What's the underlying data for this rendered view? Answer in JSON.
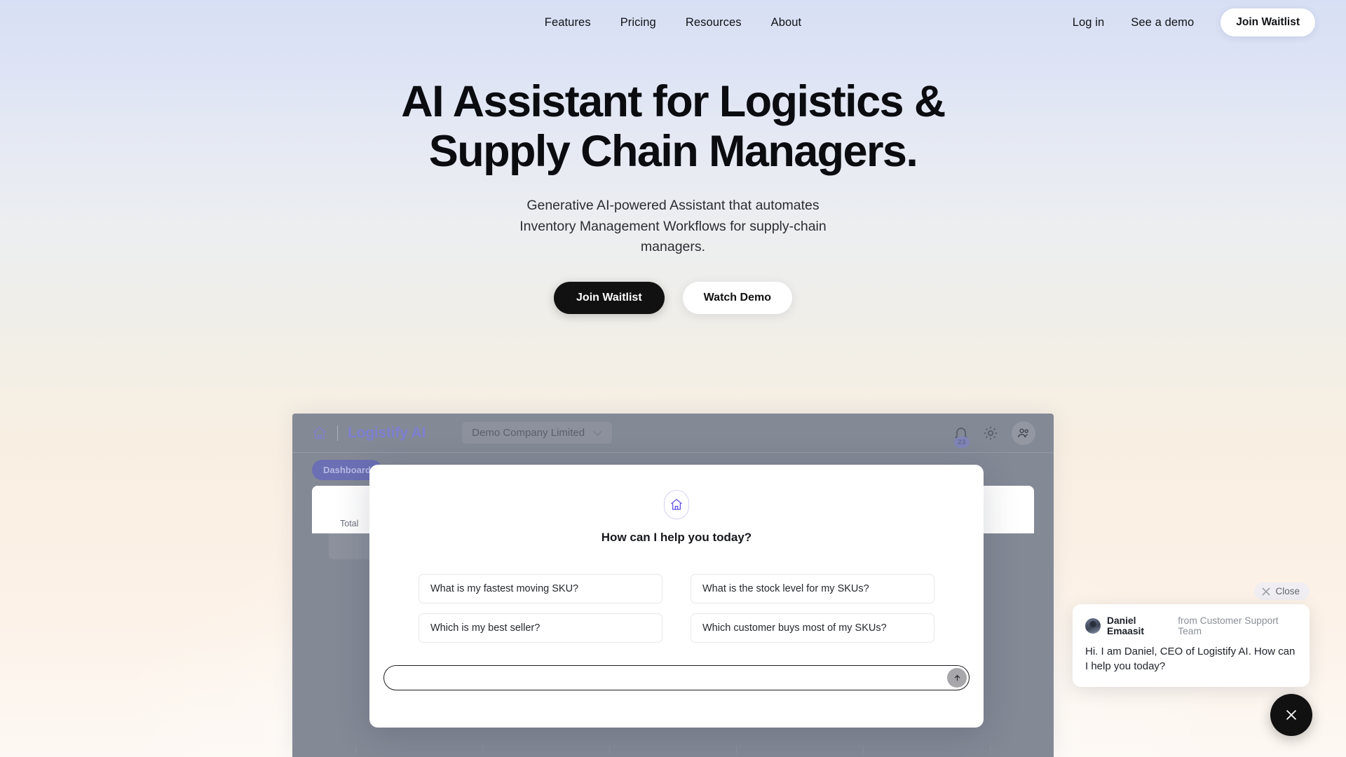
{
  "nav": {
    "links": [
      {
        "label": "Features"
      },
      {
        "label": "Pricing"
      },
      {
        "label": "Resources"
      },
      {
        "label": "About"
      }
    ],
    "login_label": "Log in",
    "demo_label": "See a demo",
    "cta_label": "Join Waitlist"
  },
  "hero": {
    "heading": "AI Assistant for Logistics & Supply Chain Managers.",
    "subheading": "Generative AI-powered Assistant that automates Inventory Management Workflows for supply-chain managers.",
    "primary_cta": "Join Waitlist",
    "secondary_cta": "Watch Demo"
  },
  "app": {
    "brand": "Logistify AI",
    "home_icon": "home-icon",
    "company": "Demo Company Limited",
    "chevron_icon": "chevron-down-icon",
    "notification_icon": "bell-icon",
    "notification_count": "23",
    "settings_icon": "gear-icon",
    "account_icon": "users-icon",
    "tab_label": "Dashboard",
    "kpi_label": "Total"
  },
  "modal": {
    "logo_icon": "home-icon",
    "title": "How can I help you today?",
    "suggestions": [
      "What is my fastest moving SKU?",
      "What is the stock level for my SKUs?",
      "Which is my best seller?",
      "Which customer buys most of my SKUs?"
    ],
    "input_placeholder": "",
    "input_value": "",
    "send_icon": "arrow-up-icon"
  },
  "chat": {
    "close_label": "Close",
    "close_icon": "close-icon",
    "sender_name": "Daniel Emaasit",
    "sender_org": "from Customer Support Team",
    "message": "Hi. I am Daniel, CEO of Logistify AI. How can I help you today?",
    "fab_icon": "close-icon"
  },
  "colors": {
    "brand_purple": "#7c7fd0",
    "dark": "#111111",
    "app_bg": "#848996",
    "tab_pill": "#6b6fb4"
  }
}
